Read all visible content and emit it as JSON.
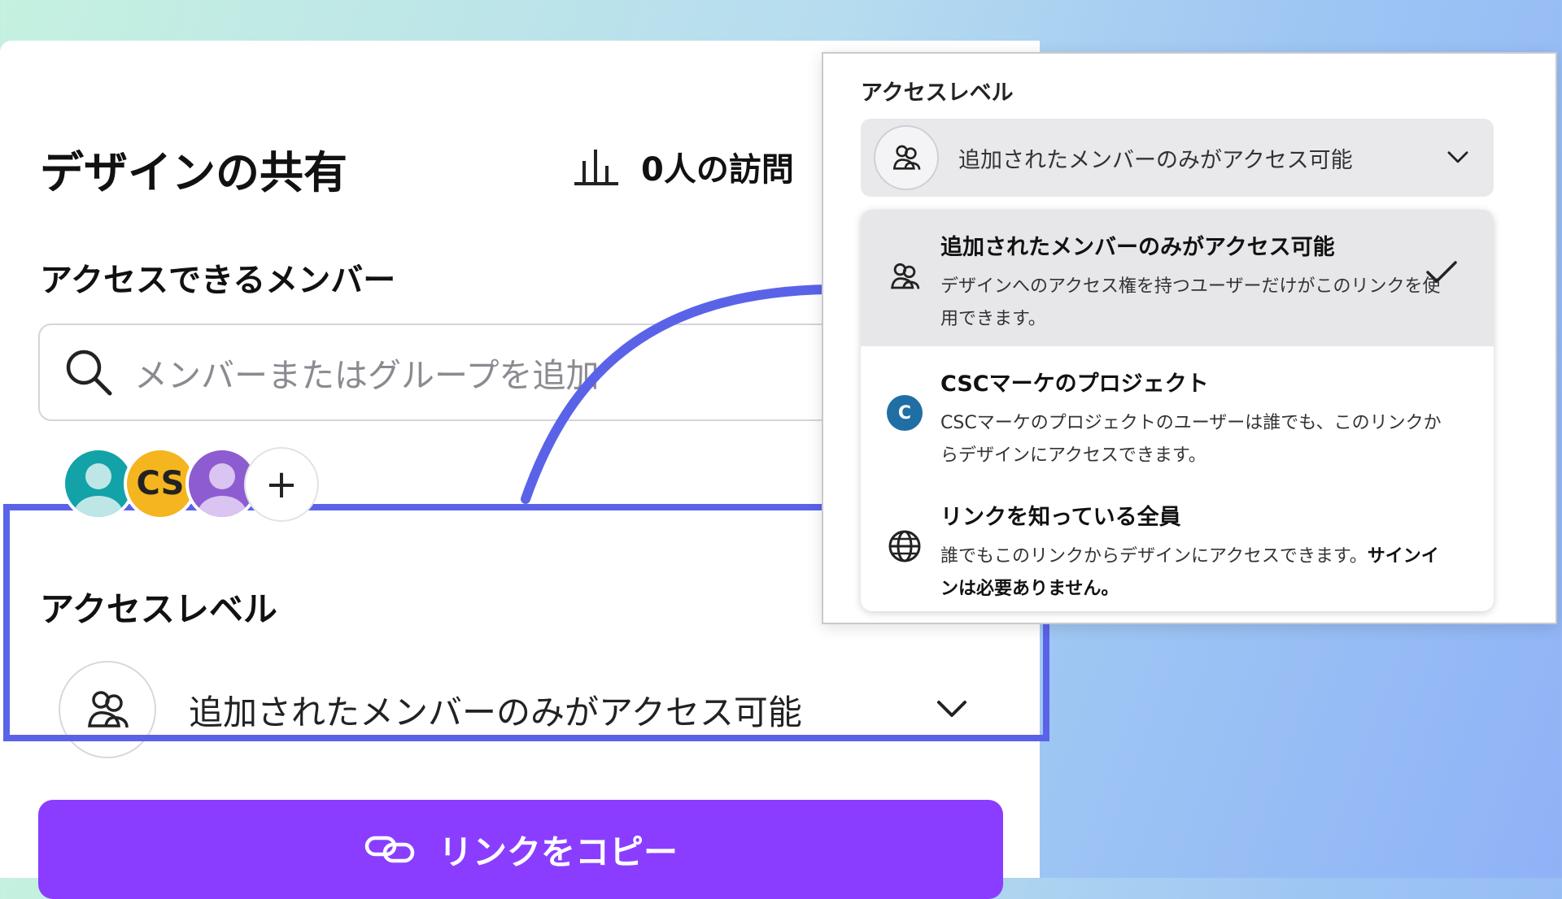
{
  "share": {
    "title": "デザインの共有",
    "visitors_label": "0人の訪問",
    "members_title": "アクセスできるメンバー",
    "search_placeholder": "メンバーまたはグループを追加",
    "avatars": [
      {
        "type": "person",
        "color": "#12a2a8"
      },
      {
        "type": "initials",
        "label": "CS",
        "color": "#f4b51f"
      },
      {
        "type": "person",
        "color": "#8d5cd0"
      },
      {
        "type": "add",
        "label": "+"
      }
    ],
    "access_title": "アクセスレベル",
    "access_value": "追加されたメンバーのみがアクセス可能",
    "copy_button": "リンクをコピー"
  },
  "dropdown": {
    "title": "アクセスレベル",
    "selected_value": "追加されたメンバーのみがアクセス可能",
    "options": [
      {
        "title": "追加されたメンバーのみがアクセス可能",
        "desc": "デザインへのアクセス権を持つユーザーだけがこのリンクを使用できます。",
        "icon": "people-icon",
        "selected": true
      },
      {
        "title": "CSCマーケのプロジェクト",
        "desc": "CSCマーケのプロジェクトのユーザーは誰でも、このリンクからデザインにアクセスできます。",
        "icon": "team-badge-icon",
        "badge": "C",
        "selected": false
      },
      {
        "title": "リンクを知っている全員",
        "desc": "誰でもこのリンクからデザインにアクセスできます。",
        "desc_bold": "サインインは必要ありません。",
        "icon": "globe-icon",
        "selected": false
      }
    ]
  },
  "colors": {
    "accent": "#8b3dff",
    "highlight": "#5a63e8",
    "background_start": "#c5f1e0",
    "background_end": "#8fb2f7"
  }
}
